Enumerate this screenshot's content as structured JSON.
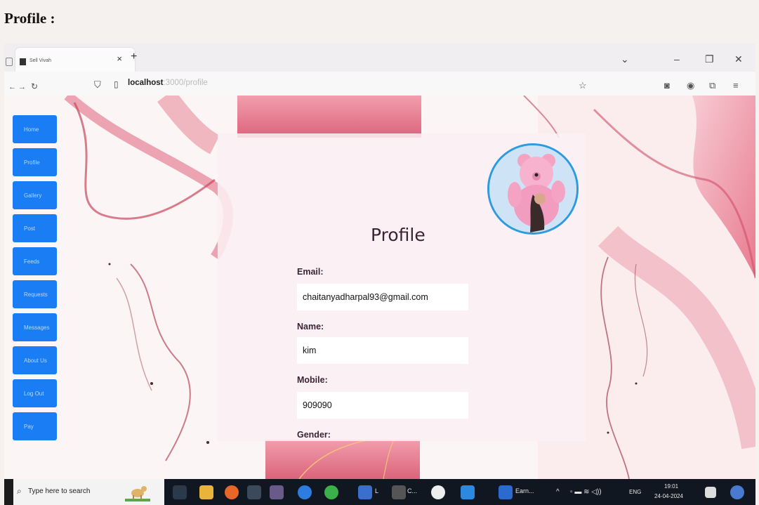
{
  "document": {
    "heading": "Profile :"
  },
  "browser": {
    "tab_title": "Sell Vivah",
    "tab_close": "×",
    "new_tab": "+",
    "url_host": "localhost",
    "url_path": ":3000/profile",
    "window_controls": {
      "list": "⌄",
      "minimize": "–",
      "restore": "❐",
      "close": "✕"
    }
  },
  "sidebar": {
    "items": [
      {
        "label": "Home"
      },
      {
        "label": "Profile"
      },
      {
        "label": "Gallery"
      },
      {
        "label": "Post"
      },
      {
        "label": "Feeds"
      },
      {
        "label": "Requests"
      },
      {
        "label": "Messages"
      },
      {
        "label": "About Us"
      },
      {
        "label": "Log Out"
      },
      {
        "label": "Pay"
      }
    ]
  },
  "profile": {
    "title": "Profile",
    "fields": [
      {
        "label": "Email:",
        "value": "chaitanyadharpal93@gmail.com"
      },
      {
        "label": "Name:",
        "value": "kim"
      },
      {
        "label": "Mobile:",
        "value": "909090"
      },
      {
        "label": "Gender:"
      }
    ]
  },
  "taskbar": {
    "search_placeholder": "Type here to search",
    "apps": [
      {
        "label": "L"
      },
      {
        "label": "C..."
      },
      {
        "label": "Earn..."
      }
    ],
    "language": "ENG",
    "time": "19:01",
    "date": "24-04-2024"
  },
  "colors": {
    "sidebar_button": "#1a7df4",
    "avatar_ring": "#2d9be0",
    "taskbar": "#101720"
  }
}
